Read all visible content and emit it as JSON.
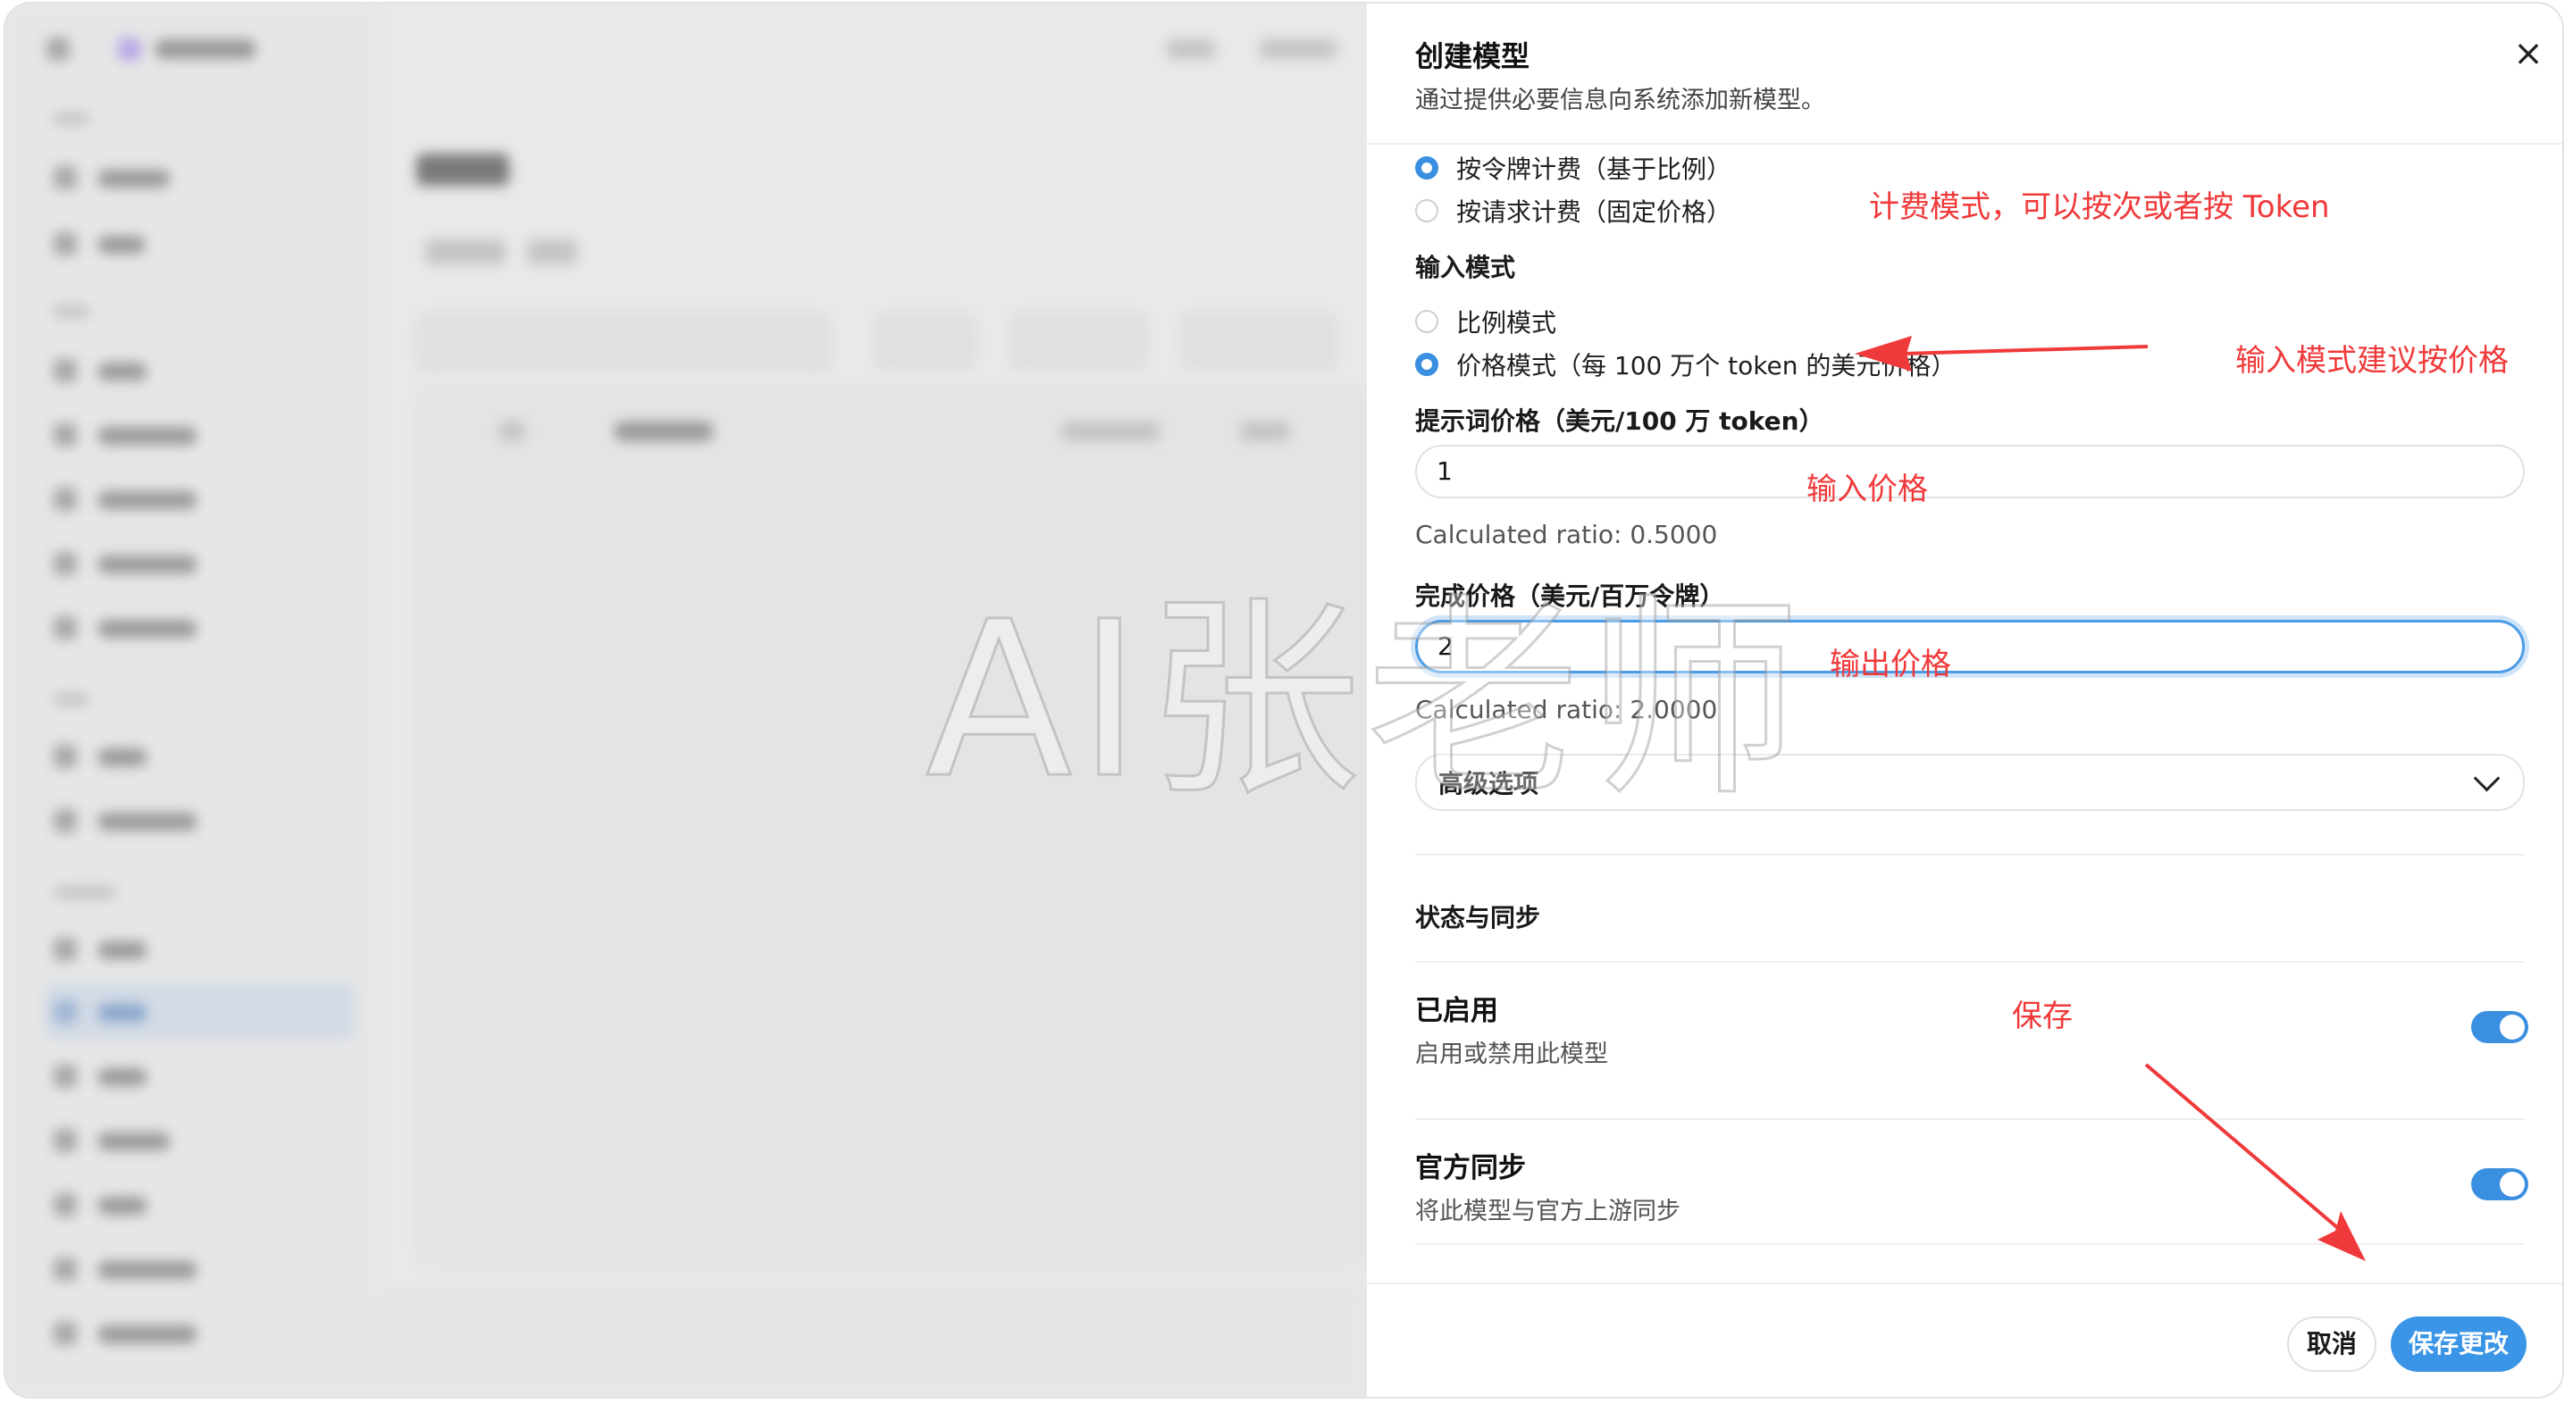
{
  "dialog": {
    "title": "创建模型",
    "subtitle": "通过提供必要信息向系统添加新模型。",
    "close_icon": "×",
    "billing_options": [
      {
        "label": "按令牌计费（基于比例）",
        "checked": true
      },
      {
        "label": "按请求计费（固定价格）",
        "checked": false
      }
    ],
    "input_mode": {
      "label": "输入模式",
      "options": [
        {
          "label": "比例模式",
          "checked": false
        },
        {
          "label": "价格模式（每 100 万个 token 的美元价格）",
          "checked": true
        }
      ]
    },
    "prompt_price": {
      "label": "提示词价格（美元/100 万 token）",
      "value": "1",
      "helper": "Calculated ratio: 0.5000"
    },
    "completion_price": {
      "label": "完成价格（美元/百万令牌）",
      "value": "2",
      "helper": "Calculated ratio: 2.0000"
    },
    "advanced_options": {
      "label": "高级选项",
      "icon": "chevron-down-icon"
    },
    "status_section": {
      "heading": "状态与同步",
      "enabled": {
        "title": "已启用",
        "description": "启用或禁用此模型",
        "on": true
      },
      "official_sync": {
        "title": "官方同步",
        "description": "将此模型与官方上游同步",
        "on": true
      }
    },
    "footer": {
      "cancel_label": "取消",
      "save_label": "保存更改"
    }
  },
  "annotations": {
    "billing_mode": "计费模式，可以按次或者按 Token",
    "input_mode_tip": "输入模式建议按价格",
    "input_price": "输入价格",
    "output_price": "输出价格",
    "save": "保存"
  },
  "watermark": "AI张老师",
  "colors": {
    "accent": "#3b8fe0",
    "annotation_red": "#f0393a",
    "focus_ring": "#cfe4f8"
  }
}
